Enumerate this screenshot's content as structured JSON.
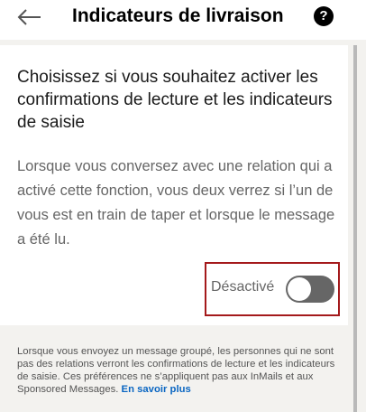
{
  "header": {
    "back_icon": "arrow-left-icon",
    "title": "Indicateurs de livraison",
    "help_icon": "question-circle-icon",
    "help_glyph": "?"
  },
  "content": {
    "headline": "Choisissez si vous souhaitez activer les confirmations de lecture et les indicateurs de saisie",
    "description": "Lorsque vous conversez avec une relation qui a activé cette fonction, vous deux verrez si l’un de vous est en train de taper et lorsque le message a été lu.",
    "toggle": {
      "label": "Désactivé",
      "state": "off"
    }
  },
  "footer": {
    "text": "Lorsque vous envoyez un message groupé, les personnes qui ne sont pas des relations verront les confirmations de lecture et les indicateurs de saisie. Ces préférences ne s’appliquent pas aux InMails et aux Sponsored Messages.",
    "link": "En savoir plus"
  },
  "colors": {
    "highlight_border": "#a4191b",
    "link": "#0a66c2",
    "toggle_track_off": "#666666"
  }
}
